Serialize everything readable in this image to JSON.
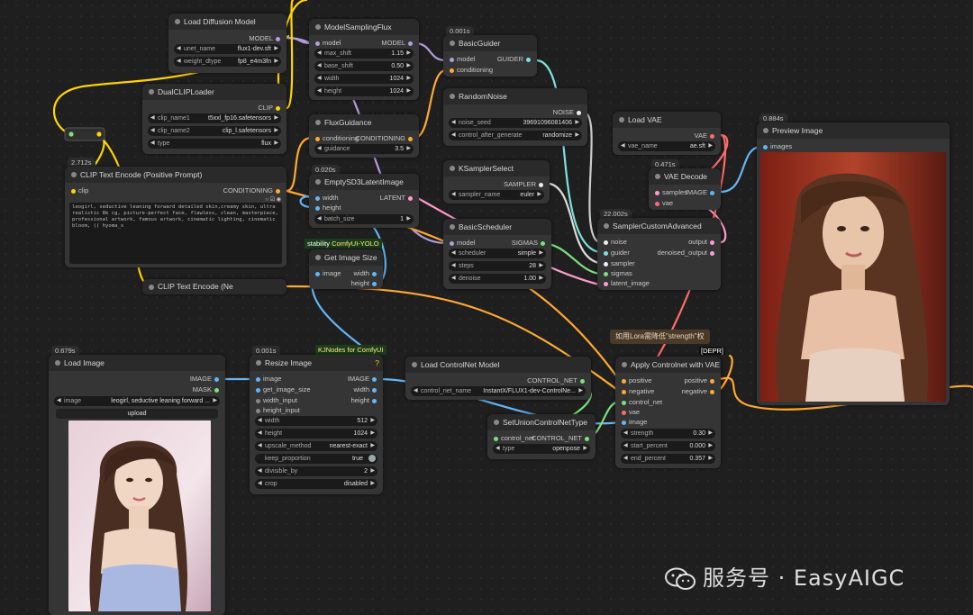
{
  "nodes": {
    "load_diffusion": {
      "title": "Load Diffusion Model",
      "out": "MODEL",
      "w1": {
        "label": "unet_name",
        "value": "flux1-dev.sft"
      },
      "w2": {
        "label": "weight_dtype",
        "value": "fp8_e4m3fn"
      }
    },
    "model_sampling": {
      "title": "ModelSamplingFlux",
      "in": "model",
      "out": "MODEL",
      "w1": {
        "label": "max_shift",
        "value": "1.15"
      },
      "w2": {
        "label": "base_shift",
        "value": "0.50"
      },
      "w3": {
        "label": "width",
        "value": "1024"
      },
      "w4": {
        "label": "height",
        "value": "1024"
      }
    },
    "basic_guider": {
      "badge": "0.001s",
      "title": "BasicGuider",
      "in1": "model",
      "in2": "conditioning",
      "out": "GUIDER"
    },
    "dual_clip": {
      "title": "DualCLIPLoader",
      "out": "CLIP",
      "w1": {
        "label": "clip_name1",
        "value": "t5xxl_fp16.safetensors"
      },
      "w2": {
        "label": "clip_name2",
        "value": "clip_l.safetensors"
      },
      "w3": {
        "label": "type",
        "value": "flux"
      }
    },
    "random_noise": {
      "title": "RandomNoise",
      "out": "NOISE",
      "w1": {
        "label": "noise_seed",
        "value": "39691096081406"
      },
      "w2": {
        "label": "control_after_generate",
        "value": "randomize"
      }
    },
    "load_vae": {
      "title": "Load VAE",
      "out": "VAE",
      "w1": {
        "label": "vae_name",
        "value": "ae.sft"
      }
    },
    "preview": {
      "badge": "0.884s",
      "title": "Preview Image",
      "in": "images"
    },
    "flux_guidance": {
      "title": "FluxGuidance",
      "in": "conditioning",
      "out": "CONDITIONING",
      "w1": {
        "label": "guidance",
        "value": "3.5"
      }
    },
    "clip_text": {
      "badge": "2.712s",
      "title": "CLIP Text Encode (Positive Prompt)",
      "in": "clip",
      "out": "CONDITIONING",
      "text": "leogirl, seductive leaning forward detailed skin,creamy skin, ultra realistic 8k cg, picture-perfect face, flawless, clean, masterpiece, professional artwork, famous artwork, cinematic lighting, cinematic bloom, (( hyoma_s"
    },
    "ksampler_select": {
      "title": "KSamplerSelect",
      "out": "SAMPLER",
      "w1": {
        "label": "sampler_name",
        "value": "euler"
      }
    },
    "vae_decode": {
      "badge": "0.471s",
      "title": "VAE Decode",
      "in1": "samples",
      "in2": "vae",
      "out": "IMAGE"
    },
    "empty_latent": {
      "badge": "0.020s",
      "title": "EmptySD3LatentImage",
      "in1": "width",
      "in2": "height",
      "out": "LATENT",
      "w1": {
        "label": "batch_size",
        "value": "1"
      }
    },
    "basic_scheduler": {
      "title": "BasicScheduler",
      "in": "model",
      "out": "SIGMAS",
      "w1": {
        "label": "scheduler",
        "value": "simple"
      },
      "w2": {
        "label": "steps",
        "value": "28"
      },
      "w3": {
        "label": "denoise",
        "value": "1.00"
      }
    },
    "sampler_custom": {
      "badge": "22.002s",
      "title": "SamplerCustomAdvanced",
      "ins": [
        "noise",
        "guider",
        "sampler",
        "sigmas",
        "latent_image"
      ],
      "out1": "output",
      "out2": "denoised_output"
    },
    "get_image_size": {
      "title": "Get Image Size",
      "in": "image",
      "out1": "width",
      "out2": "height"
    },
    "clip_text2": {
      "title": "CLIP Text Encode (Ne"
    },
    "load_image": {
      "badge": "0.679s",
      "title": "Load Image",
      "out1": "IMAGE",
      "out2": "MASK",
      "w1": {
        "label": "image",
        "value": "leogirl, seductive leaning forward ..."
      },
      "upload": "upload"
    },
    "resize_image": {
      "badge": "0.001s",
      "title": "Resize Image",
      "help": "?",
      "in1": "image",
      "in2": "get_image_size",
      "in3": "width_input",
      "in4": "height_input",
      "out1": "IMAGE",
      "out2": "width",
      "out3": "height",
      "w1": {
        "label": "width",
        "value": "512"
      },
      "w2": {
        "label": "height",
        "value": "1024"
      },
      "w3": {
        "label": "upscale_method",
        "value": "nearest-exact"
      },
      "w4": {
        "label": "keep_proportion",
        "value": "true"
      },
      "w5": {
        "label": "divisible_by",
        "value": "2"
      },
      "w6": {
        "label": "crop",
        "value": "disabled"
      }
    },
    "load_controlnet": {
      "title": "Load ControlNet Model",
      "out": "CONTROL_NET",
      "w1": {
        "label": "control_net_name",
        "value": "InstantX/FLUX1-dev-ControlNe..."
      }
    },
    "set_union": {
      "title": "SetUnionControlNetType",
      "in": "control_net",
      "out": "CONTROL_NET",
      "w1": {
        "label": "type",
        "value": "openpose"
      }
    },
    "apply_controlnet": {
      "title": "Apply Controlnet with VAE",
      "tag": "[DEPR]",
      "ins": [
        "positive",
        "negative",
        "control_net",
        "vae",
        "image"
      ],
      "out1": "positive",
      "out2": "negative",
      "w1": {
        "label": "strength",
        "value": "0.30"
      },
      "w2": {
        "label": "start_percent",
        "value": "0.000"
      },
      "w3": {
        "label": "end_percent",
        "value": "0.357"
      }
    }
  },
  "chips": {
    "stability": "stability",
    "yolo": "ComfyUI-YOLO",
    "kjnodes": "KJNodes for ComfyUI"
  },
  "note": "如用Lora需降低\"strength\"权",
  "watermark": {
    "text": "服务号 · EasyAIGC",
    "icon": "wechat-icon"
  }
}
